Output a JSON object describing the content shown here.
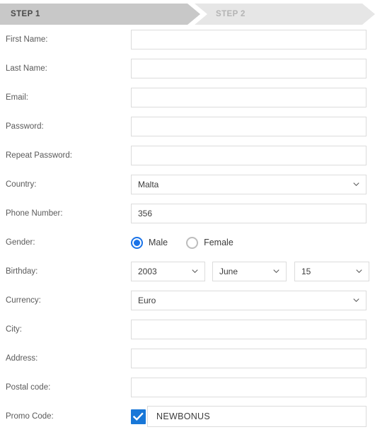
{
  "steps": [
    {
      "label": "STEP 1",
      "state": "active"
    },
    {
      "label": "STEP 2",
      "state": "inactive"
    }
  ],
  "colors": {
    "step_active_bg": "#c8c8c8",
    "step_inactive_bg": "#e6e6e6",
    "accent": "#1a73e8",
    "checkbox": "#1877d8",
    "field_border": "#dcdcdc",
    "label_text": "#5a5a5a"
  },
  "form": {
    "first_name": {
      "label": "First Name:",
      "value": "",
      "placeholder": ""
    },
    "last_name": {
      "label": "Last Name:",
      "value": "",
      "placeholder": ""
    },
    "email": {
      "label": "Email:",
      "value": "",
      "placeholder": ""
    },
    "password": {
      "label": "Password:",
      "value": "",
      "placeholder": ""
    },
    "repeat_password": {
      "label": "Repeat Password:",
      "value": "",
      "placeholder": ""
    },
    "country": {
      "label": "Country:",
      "value": "Malta",
      "icon": "chevron-down-icon"
    },
    "phone_number": {
      "label": "Phone Number:",
      "value": "356",
      "placeholder": ""
    },
    "gender": {
      "label": "Gender:",
      "options": [
        {
          "label": "Male",
          "selected": true
        },
        {
          "label": "Female",
          "selected": false
        }
      ]
    },
    "birthday": {
      "label": "Birthday:",
      "year": "2003",
      "month": "June",
      "day": "15"
    },
    "currency": {
      "label": "Currency:",
      "value": "Euro",
      "icon": "chevron-down-icon"
    },
    "city": {
      "label": "City:",
      "value": "",
      "placeholder": ""
    },
    "address": {
      "label": "Address:",
      "value": "",
      "placeholder": ""
    },
    "postal_code": {
      "label": "Postal code:",
      "value": "",
      "placeholder": ""
    },
    "promo_code": {
      "label": "Promo Code:",
      "checked": true,
      "value": "NEWBONUS",
      "placeholder": ""
    }
  }
}
